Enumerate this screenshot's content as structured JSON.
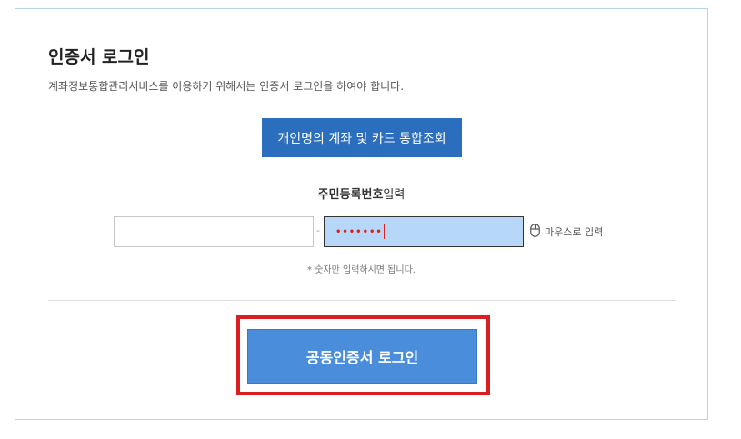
{
  "login": {
    "title": "인증서 로그인",
    "description": "계좌정보통합관리서비스를 이용하기 위해서는 인증서 로그인을 하여야 합니다.",
    "inquiry_button": "개인명의 계좌 및 카드 통합조회",
    "ssn_label_bold": "주민등록번호",
    "ssn_label_rest": "입력",
    "ssn_front_value": "",
    "ssn_separator": "-",
    "ssn_back_masked": "•••••••",
    "mouse_input_label": "마우스로 입력",
    "hint": "* 숫자만 입력하시면 됩니다.",
    "login_button": "공동인증서 로그인"
  },
  "colors": {
    "primary_button": "#2a6ebd",
    "login_button": "#4a8edb",
    "highlight_border": "#d91f1f",
    "focused_input_bg": "#b7d7f8"
  }
}
